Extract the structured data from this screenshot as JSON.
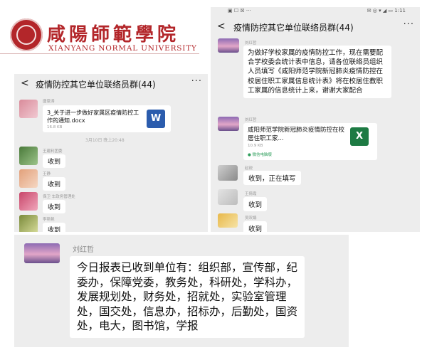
{
  "logo": {
    "name_cn": "咸陽師範學院",
    "name_en": "XIANYANG NORMAL UNIVERSITY"
  },
  "left_chat": {
    "back_glyph": "<",
    "title": "疫情防控其它单位联络员群(44)",
    "more_glyph": "···",
    "messages": [
      {
        "sender": "唐恩涛",
        "file_name": "3_关于进一步做好家属区疫情防控工作的通知.docx",
        "file_size": "16.8 KB",
        "file_type": "W"
      },
      {
        "system": "3月10日 晚上20:48"
      },
      {
        "sender": "王建利团委",
        "text": "收到"
      },
      {
        "sender": "王静",
        "text": "收到"
      },
      {
        "sender": "保卫 车政务管理处",
        "text": "收到"
      },
      {
        "sender": "李艳艳",
        "text": "收到"
      }
    ]
  },
  "right_chat": {
    "status_bar": {
      "left": "▣ ☐ ☒ ···",
      "right": "✉ ◎ ▾ ◢ ▭ 1:11"
    },
    "back_glyph": "<",
    "title": "疫情防控其它单位联络员群(44)",
    "more_glyph": "···",
    "messages": [
      {
        "sender": "刘红哲",
        "text": "为做好学校家属的疫情防控工作，现在需要配合学校委会统计表中信息，请各位联络员组织人员填写《咸阳师范学院新冠肺炎疫情防控在校居住职工家属信息统计表》将在校居住教职工家属的信息统计上来，谢谢大家配合"
      },
      {
        "sender": "刘红哲",
        "file_name": "咸阳师范学院新冠肺炎疫情防控在校居住职工家...",
        "file_size": "10.9 KB",
        "file_type": "X",
        "source": "● 微信电脑版"
      },
      {
        "sender": "赵锐",
        "text": "收到，正在填写"
      },
      {
        "sender": "王倩霞",
        "text": "收到"
      },
      {
        "sender": "吴叹娟",
        "text": "收到"
      }
    ]
  },
  "bottom_message": {
    "sender": "刘红哲",
    "text": "今日报表已收到单位有：组织部，宣传部，纪委办，保障党委，教务处，科研处，学科办，发展规划处，财务处，招就处，实验室管理处，国交处，信息办，招标办，后勤处，国资处，电大，图书馆，学报"
  },
  "colors": {
    "brand_red": "#b3262a",
    "chat_bg": "#ededed",
    "bubble_bg": "#ffffff",
    "word_blue": "#2b5cad",
    "excel_green": "#1d7a43"
  }
}
